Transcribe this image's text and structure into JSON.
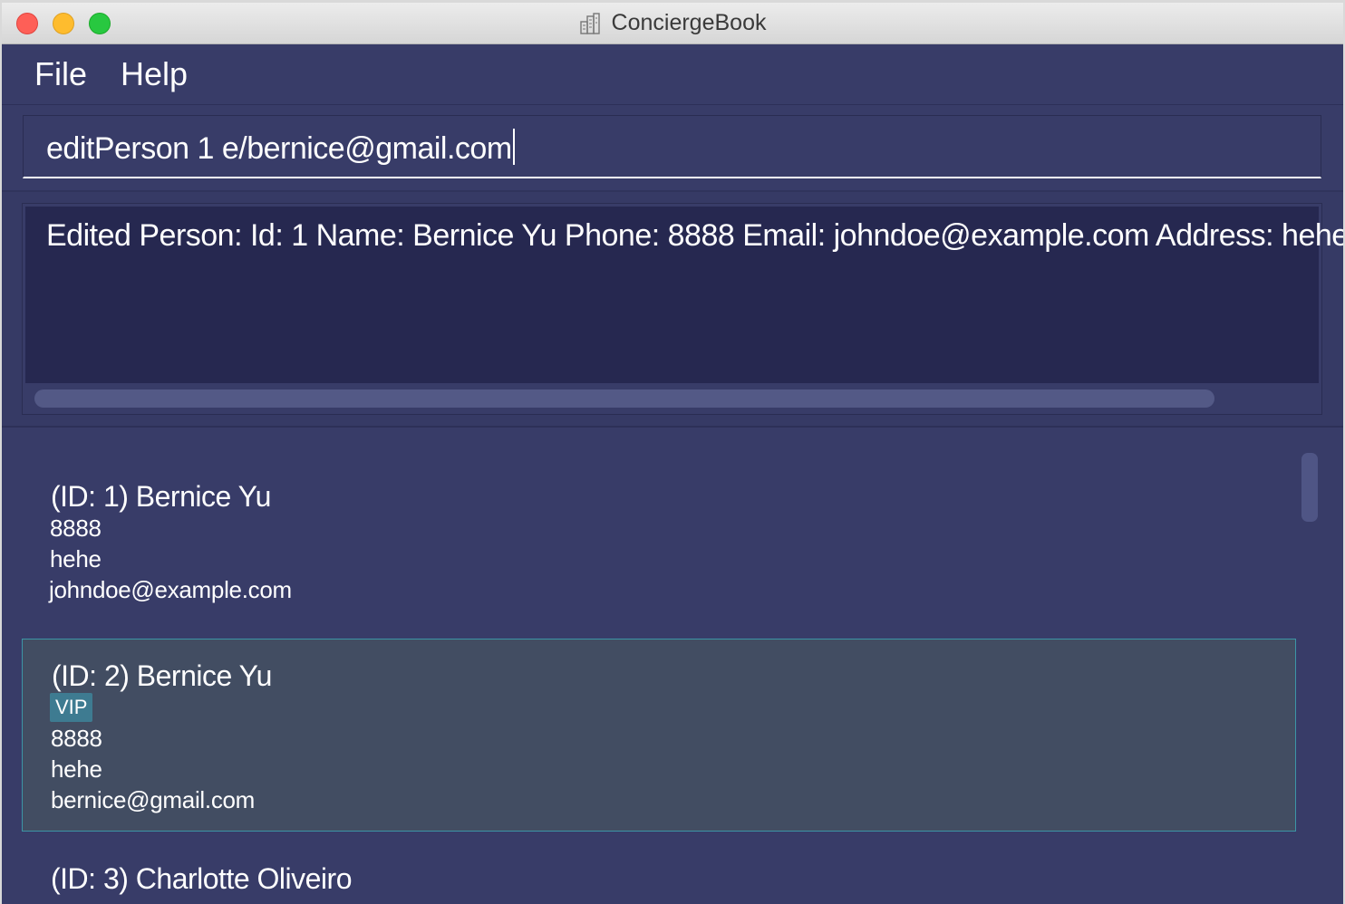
{
  "window": {
    "title": "ConciergeBook",
    "app_icon": "building-icon"
  },
  "menu": {
    "file": "File",
    "help": "Help"
  },
  "command": {
    "value": "editPerson 1 e/bernice@gmail.com"
  },
  "result": {
    "text": "Edited Person: Id: 1 Name: Bernice Yu Phone: 8888 Email: johndoe@example.com Address: hehe"
  },
  "persons": [
    {
      "heading": "(ID: 1) Bernice Yu",
      "tags": [],
      "phone": "8888",
      "address": "hehe",
      "email": "johndoe@example.com"
    },
    {
      "heading": "(ID: 2) Bernice Yu",
      "tags": [
        "VIP"
      ],
      "phone": "8888",
      "address": "hehe",
      "email": "bernice@gmail.com"
    },
    {
      "heading": "(ID: 3) Charlotte Oliveiro",
      "tags": [],
      "phone": "",
      "address": "",
      "email": ""
    }
  ],
  "colors": {
    "background": "#383c68",
    "result_bg": "#262850",
    "selected_card": "#424d62",
    "selected_border": "#3c95a6",
    "tag_bg": "#3e7b91"
  }
}
